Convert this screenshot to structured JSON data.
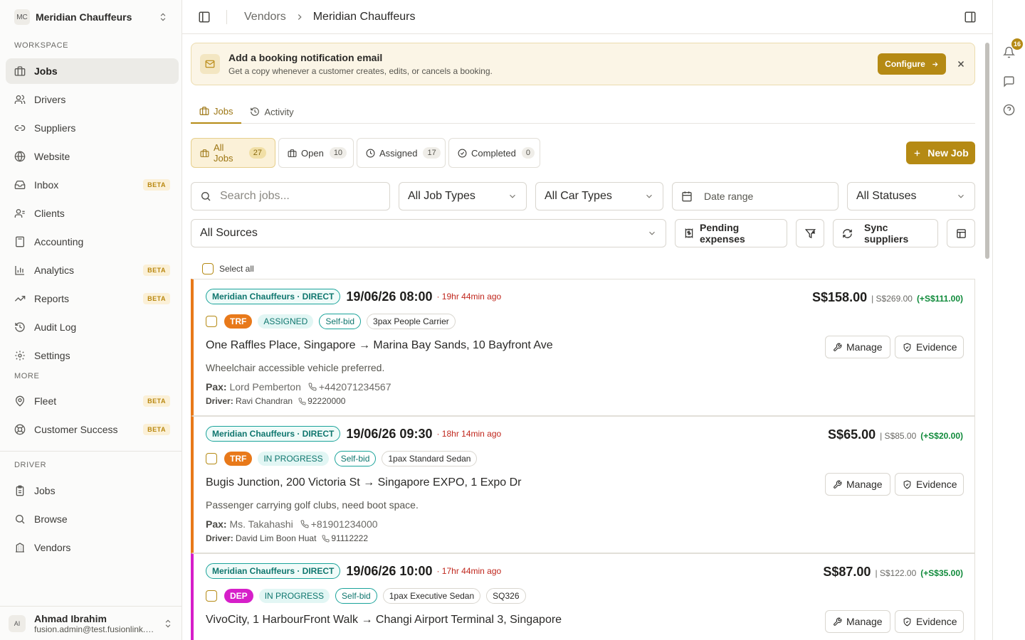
{
  "org": {
    "initials": "MC",
    "name": "Meridian Chauffeurs"
  },
  "sections": {
    "workspace": "WORKSPACE",
    "more": "MORE",
    "driver": "DRIVER"
  },
  "nav": {
    "workspace": [
      {
        "label": "Jobs",
        "badge": ""
      },
      {
        "label": "Drivers",
        "badge": ""
      },
      {
        "label": "Suppliers",
        "badge": ""
      },
      {
        "label": "Website",
        "badge": ""
      },
      {
        "label": "Inbox",
        "badge": "BETA"
      },
      {
        "label": "Clients",
        "badge": ""
      },
      {
        "label": "Accounting",
        "badge": ""
      },
      {
        "label": "Analytics",
        "badge": "BETA"
      },
      {
        "label": "Reports",
        "badge": "BETA"
      },
      {
        "label": "Audit Log",
        "badge": ""
      },
      {
        "label": "Settings",
        "badge": ""
      }
    ],
    "more": [
      {
        "label": "Fleet",
        "badge": "BETA"
      },
      {
        "label": "Customer Success",
        "badge": "BETA"
      }
    ],
    "driver": [
      {
        "label": "Jobs"
      },
      {
        "label": "Browse"
      },
      {
        "label": "Vendors"
      }
    ]
  },
  "user": {
    "initials": "AI",
    "name": "Ahmad Ibrahim",
    "email": "fusion.admin@test.fusionlink.a..."
  },
  "breadcrumb": {
    "parent": "Vendors",
    "current": "Meridian Chauffeurs"
  },
  "rail": {
    "notification_count": "16"
  },
  "banner": {
    "title": "Add a booking notification email",
    "subtitle": "Get a copy whenever a customer creates, edits, or cancels a booking.",
    "configure_label": "Configure"
  },
  "tabs": {
    "jobs": "Jobs",
    "activity": "Activity"
  },
  "status_filters": [
    {
      "label": "All Jobs",
      "count": "27"
    },
    {
      "label": "Open",
      "count": "10"
    },
    {
      "label": "Assigned",
      "count": "17"
    },
    {
      "label": "Completed",
      "count": "0"
    }
  ],
  "new_job_label": "New Job",
  "filters": {
    "search_placeholder": "Search jobs...",
    "job_types": "All Job Types",
    "car_types": "All Car Types",
    "date_range": "Date range",
    "statuses": "All Statuses",
    "sources": "All Sources",
    "pending_expenses": "Pending expenses",
    "sync_suppliers": "Sync suppliers"
  },
  "select_all": "Select all",
  "card_actions": {
    "manage": "Manage",
    "evidence": "Evidence"
  },
  "jobs": [
    {
      "source": "Meridian Chauffeurs · DIRECT",
      "datetime": "19/06/26 08:00",
      "ago": "· 19hr 44min ago",
      "price": "S$158.00",
      "original": "| S$269.00",
      "diff": "(+S$111.00)",
      "type": "TRF",
      "status": "ASSIGNED",
      "bid": "Self-bid",
      "car": "3pax People Carrier",
      "route": "One Raffles Place, Singapore → Marina Bay Sands, 10 Bayfront Ave",
      "note": "Wheelchair accessible vehicle preferred.",
      "pax_label": "Pax:",
      "pax": "Lord Pemberton",
      "pax_phone": "+442071234567",
      "driver_label": "Driver:",
      "driver": "Ravi Chandran",
      "driver_phone": "92220000"
    },
    {
      "source": "Meridian Chauffeurs · DIRECT",
      "datetime": "19/06/26 09:30",
      "ago": "· 18hr 14min ago",
      "price": "S$65.00",
      "original": "| S$85.00",
      "diff": "(+S$20.00)",
      "type": "TRF",
      "status": "IN PROGRESS",
      "bid": "Self-bid",
      "car": "1pax Standard Sedan",
      "route": "Bugis Junction, 200 Victoria St → Singapore EXPO, 1 Expo Dr",
      "note": "Passenger carrying golf clubs, need boot space.",
      "pax_label": "Pax:",
      "pax": "Ms. Takahashi",
      "pax_phone": "+81901234000",
      "driver_label": "Driver:",
      "driver": "David Lim Boon Huat",
      "driver_phone": "91112222"
    },
    {
      "source": "Meridian Chauffeurs · DIRECT",
      "datetime": "19/06/26 10:00",
      "ago": "· 17hr 44min ago",
      "price": "S$87.00",
      "original": "| S$122.00",
      "diff": "(+S$35.00)",
      "type": "DEP",
      "status": "IN PROGRESS",
      "bid": "Self-bid",
      "car": "1pax Executive Sedan",
      "flight": "SQ326",
      "route": "VivoCity, 1 HarbourFront Walk → Changi Airport Terminal 3, Singapore"
    }
  ]
}
